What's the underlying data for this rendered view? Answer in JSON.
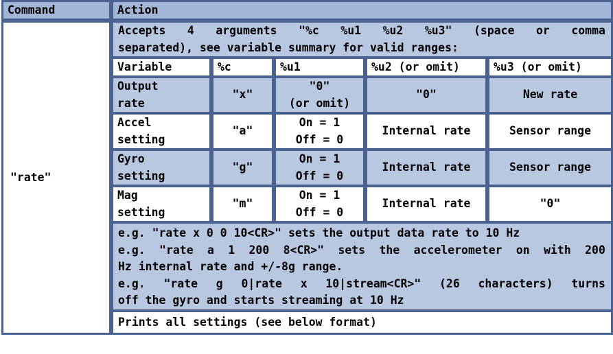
{
  "table": {
    "headers": {
      "command": "Command",
      "action": "Action"
    },
    "command": "\"rate\"",
    "intro": {
      "line1_words": [
        "Accepts",
        "4",
        "arguments",
        "\"%c",
        "%u1",
        "%u2",
        "%u3\"",
        "(space",
        "or",
        "comma"
      ],
      "line2": "separated), see variable summary for valid ranges:"
    },
    "variable_table": {
      "columns": [
        "Variable",
        "%c",
        "%u1",
        "%u2 (or omit)",
        "%u3 (or omit)"
      ],
      "rows": [
        {
          "variable": [
            "Output",
            "rate"
          ],
          "c": "\"x\"",
          "u1": [
            "\"0\"",
            "(or omit)"
          ],
          "u2": "\"0\"",
          "u3": "New rate"
        },
        {
          "variable": [
            "Accel",
            "setting"
          ],
          "c": "\"a\"",
          "u1": [
            "On = 1",
            "Off = 0"
          ],
          "u2": "Internal rate",
          "u3": "Sensor range"
        },
        {
          "variable": [
            "Gyro",
            "setting"
          ],
          "c": "\"g\"",
          "u1": [
            "On = 1",
            "Off = 0"
          ],
          "u2": "Internal rate",
          "u3": "Sensor range"
        },
        {
          "variable": [
            "Mag",
            "setting"
          ],
          "c": "\"m\"",
          "u1": [
            "On = 1",
            "Off = 0"
          ],
          "u2": "Internal rate",
          "u3": "\"0\""
        }
      ]
    },
    "examples": {
      "line1": "e.g. \"rate x 0 0 10<CR>\" sets the output data rate to 10 Hz",
      "line2_words": [
        "e.g.",
        "\"rate",
        "a",
        "1",
        "200",
        "8<CR>\"",
        "sets",
        "the",
        "accelerometer",
        "on",
        "with",
        "200"
      ],
      "line3": "Hz internal rate and +/-8g range.",
      "line4_words": [
        "e.g.",
        "\"rate",
        "g",
        "0|rate",
        "x",
        "10|stream<CR>\"",
        "(26",
        "characters)",
        "turns"
      ],
      "line5": "off the gyro and starts streaming at 10 Hz"
    },
    "print_row": "Prints all settings (see below format)"
  }
}
